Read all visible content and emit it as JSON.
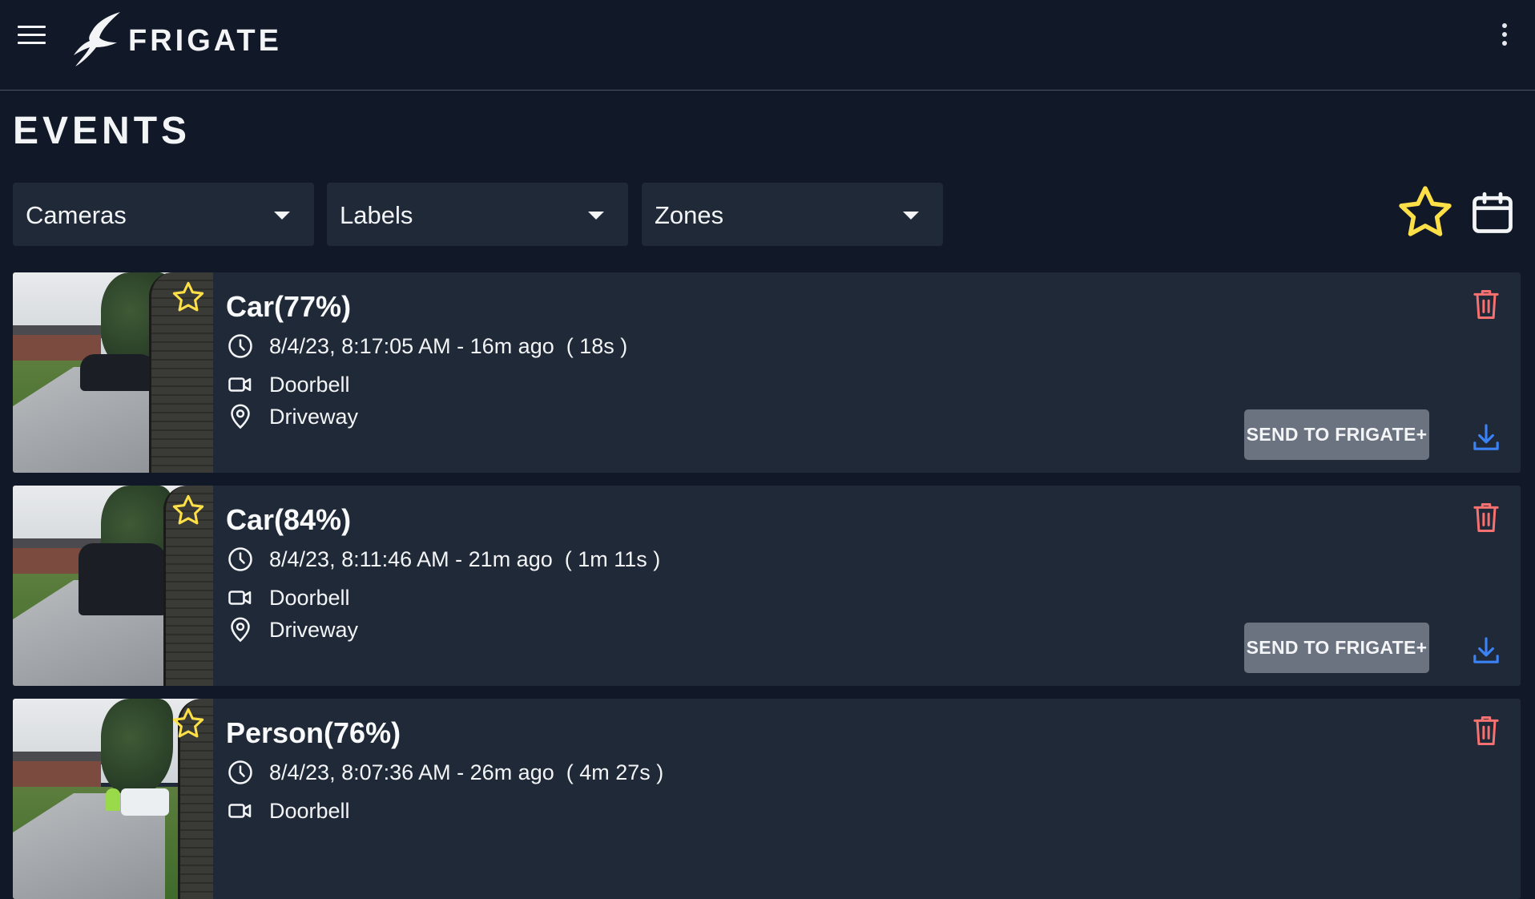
{
  "app": {
    "brand": "FRIGATE"
  },
  "page": {
    "title": "EVENTS"
  },
  "filters": [
    {
      "label": "Cameras"
    },
    {
      "label": "Labels"
    },
    {
      "label": "Zones"
    }
  ],
  "colors": {
    "background": "#111827",
    "card": "#1f2937",
    "star": "#fde047",
    "trash": "#f87171",
    "download": "#3b82f6",
    "button": "#6b7280"
  },
  "events": [
    {
      "title": "Car(77%)",
      "time": "8/4/23, 8:17:05 AM - 16m ago  ( 18s )",
      "camera": "Doorbell",
      "zone": "Driveway",
      "send_label": "SEND TO FRIGATE+"
    },
    {
      "title": "Car(84%)",
      "time": "8/4/23, 8:11:46 AM - 21m ago  ( 1m 11s )",
      "camera": "Doorbell",
      "zone": "Driveway",
      "send_label": "SEND TO FRIGATE+"
    },
    {
      "title": "Person(76%)",
      "time": "8/4/23, 8:07:36 AM - 26m ago  ( 4m 27s )",
      "camera": "Doorbell",
      "zone": "",
      "send_label": ""
    }
  ]
}
